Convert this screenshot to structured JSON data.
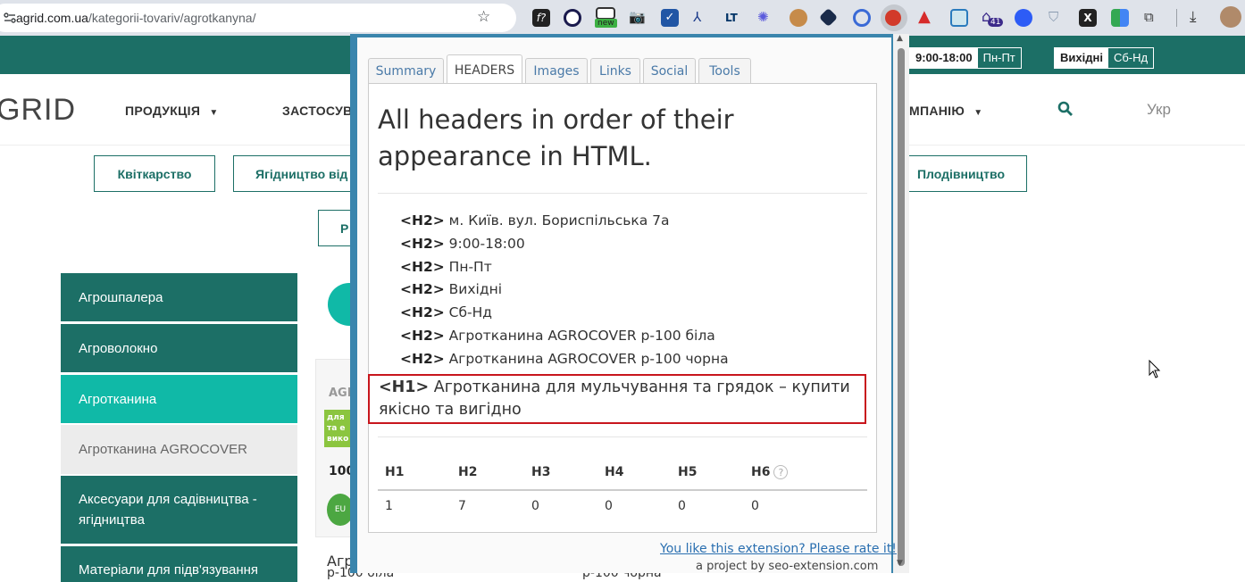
{
  "browser": {
    "url_host": "agrid.com.ua",
    "url_path": "/kategorii-tovariv/agrotkanyna/",
    "new_badge": "new",
    "ext_badge_count": "41"
  },
  "site": {
    "hours_time": "9:00-18:00",
    "hours_days": "Пн-Пт",
    "weekend_label": "Вихідні",
    "weekend_days": "Сб-Нд",
    "logo_text": "GRID",
    "nav": {
      "products": "ПРОДУКЦІЯ",
      "apply": "ЗАСТОСУВ",
      "company": "МПАНІЮ",
      "language": "Укр"
    },
    "categories": [
      "Квіткарство",
      "Ягідництво від",
      "Плодівництво",
      "Р"
    ],
    "sidebar": [
      "Агрошпалера",
      "Агроволокно",
      "Агротканина",
      "Агротканина AGROCOVER",
      "Аксесуари для садівництва - ягідництва",
      "Матеріали для підв'язування"
    ],
    "product_peek": {
      "brand": "AGR",
      "label_lines": [
        "для",
        "та е",
        "вико"
      ],
      "price": "100",
      "eu": "EU",
      "name_left": "Агр",
      "name_left_sub": "р-100 біла",
      "name_right_sub": "р-100 чорна"
    }
  },
  "popup": {
    "tabs": [
      "Summary",
      "HEADERS",
      "Images",
      "Links",
      "Social",
      "Tools"
    ],
    "active_tab": "HEADERS",
    "title": "All headers in order of their appearance in HTML.",
    "headers": [
      {
        "tag": "<H2>",
        "text": "м. Київ. вул. Бориспільська 7а"
      },
      {
        "tag": "<H2>",
        "text": "9:00-18:00"
      },
      {
        "tag": "<H2>",
        "text": "Пн-Пт"
      },
      {
        "tag": "<H2>",
        "text": "Вихідні"
      },
      {
        "tag": "<H2>",
        "text": "Сб-Нд"
      },
      {
        "tag": "<H2>",
        "text": "Агротканина AGROCOVER р-100 біла"
      },
      {
        "tag": "<H2>",
        "text": "Агротканина AGROCOVER р-100 чорна"
      }
    ],
    "h1": {
      "tag": "<H1>",
      "text": "Агротканина для мульчування та грядок – купити якісно та вигідно"
    },
    "counts": {
      "labels": [
        "H1",
        "H2",
        "H3",
        "H4",
        "H5",
        "H6"
      ],
      "values": [
        "1",
        "7",
        "0",
        "0",
        "0",
        "0"
      ],
      "help": "?"
    },
    "footer_link": "You like this extension? Please rate it!",
    "footer_sub": "a project by seo-extension.com"
  },
  "colors": {
    "site_green": "#1c6f66",
    "site_teal": "#10b9a7",
    "popup_border": "#3a85ad",
    "highlight_red": "#c8161d",
    "link_blue": "#2a6fb0"
  }
}
